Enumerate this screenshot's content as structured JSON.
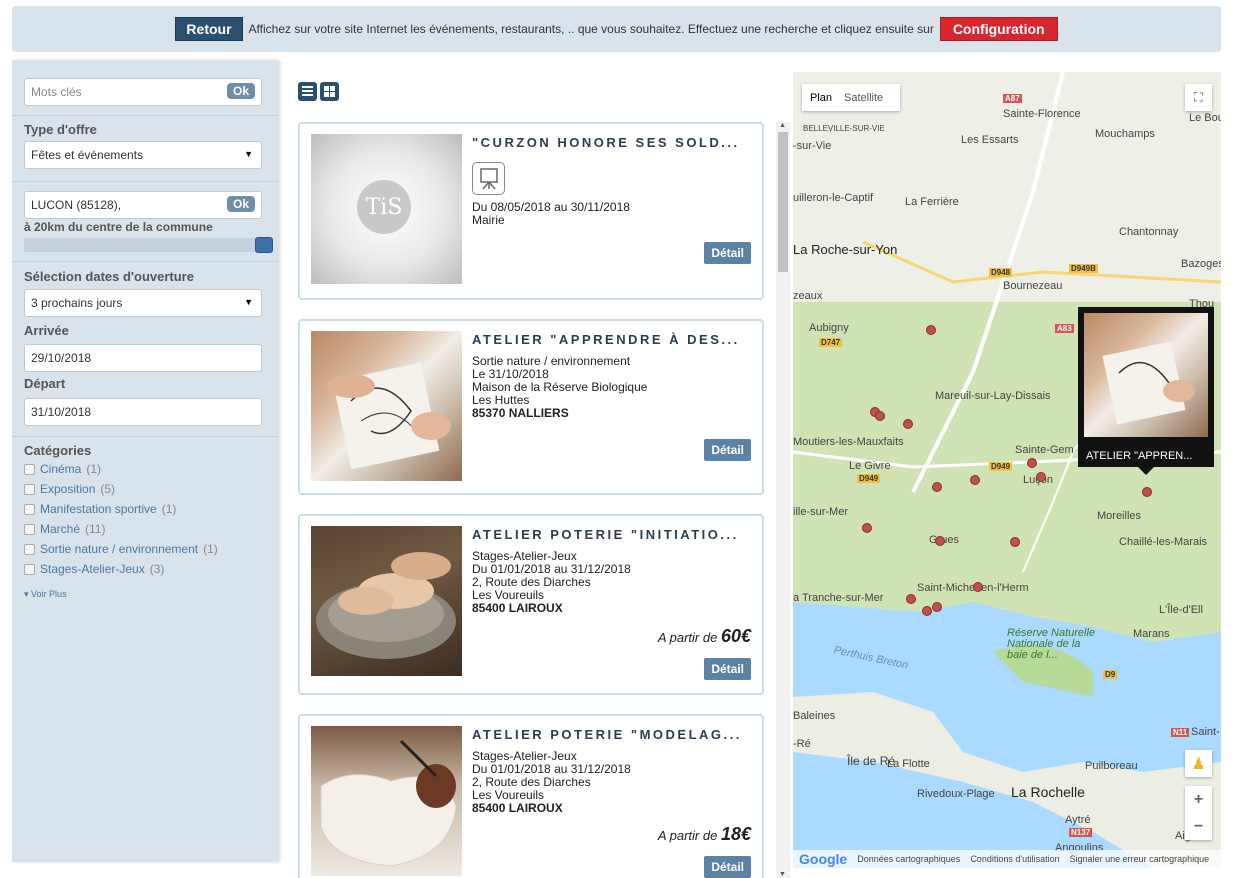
{
  "topbar": {
    "retour_label": "Retour",
    "message": "Affichez sur votre site Internet les événements, restaurants, .. que vous souhaitez. Effectuez une recherche et cliquez ensuite sur",
    "config_label": "Configuration"
  },
  "sidebar": {
    "keywords_placeholder": "Mots clés",
    "ok_label": "Ok",
    "type_label": "Type d'offre",
    "type_value": "Fêtes et événements",
    "location_value": "LUCON (85128),",
    "radius_label": "à 20km du centre de la commune",
    "radius_level": 1.0,
    "dates_label": "Sélection dates d'ouverture",
    "dates_value": "3 prochains jours",
    "arrival_label": "Arrivée",
    "arrival_value": "29/10/2018",
    "departure_label": "Départ",
    "departure_value": "31/10/2018",
    "categories_label": "Catégories",
    "categories": [
      {
        "name": "Cinéma",
        "count": "(1)"
      },
      {
        "name": "Exposition",
        "count": "(5)"
      },
      {
        "name": "Manifestation sportive",
        "count": "(1)"
      },
      {
        "name": "Marché",
        "count": "(11)"
      },
      {
        "name": "Sortie nature / environnement",
        "count": "(1)"
      },
      {
        "name": "Stages-Atelier-Jeux",
        "count": "(3)"
      }
    ],
    "more_label": "Voir Plus"
  },
  "list": {
    "detail_label": "Détail",
    "price_prefix": "A partir de",
    "cards": [
      {
        "title": "\"CURZON HONORE SES SOLD...",
        "lines": [
          "Du 08/05/2018 au 30/11/2018",
          "Mairie"
        ],
        "placeholder_logo": "TiS"
      },
      {
        "title": "ATELIER \"APPRENDRE À DES...",
        "lines": [
          "Sortie nature / environnement",
          "Le 31/10/2018",
          "Maison de la Réserve Biologique",
          "Les Huttes"
        ],
        "postal": "85370",
        "city": "NALLIERS"
      },
      {
        "title": "ATELIER POTERIE \"INITIATIO...",
        "lines": [
          "Stages-Atelier-Jeux",
          "Du 01/01/2018 au 31/12/2018",
          "2, Route des Diarches",
          "Les Voureuils"
        ],
        "postal": "85400",
        "city": "LAIROUX",
        "price": "60€"
      },
      {
        "title": "ATELIER POTERIE \"MODELAG...",
        "lines": [
          "Stages-Atelier-Jeux",
          "Du 01/01/2018 au 31/12/2018",
          "2, Route des Diarches",
          "Les Voureuils"
        ],
        "postal": "85400",
        "city": "LAIROUX",
        "price": "18€"
      }
    ]
  },
  "map": {
    "plan_label": "Plan",
    "satellite_label": "Satellite",
    "popup_title": "ATELIER \"APPREN...",
    "footer_google": "Google",
    "footer_data": "Données cartographiques",
    "footer_terms": "Conditions d'utilisation",
    "footer_report": "Signaler une erreur cartographique",
    "places": [
      "Sainte-Florence",
      "Le Bou",
      "BELLEVILLE-SUR-VIE",
      "Mouchamps",
      "Les Essarts",
      "-sur-Vie",
      "uilleron-le-Captif",
      "La Ferrière",
      "Chantonnay",
      "La Roche-sur-Yon",
      "Bazoges-",
      "Bournezeau",
      "Thou",
      "zeaux",
      "Aubigny",
      "Mareuil-sur-Lay-Dissais",
      "Moutiers-les-Mauxfaits",
      "Sainte-Gem",
      "Le Givre",
      "Luçon",
      "ille-sur-Mer",
      "Moreilles",
      "Grues",
      "Chaillé-les-Marais",
      "Saint-Michel-en-l'Herm",
      "a Tranche-sur-Mer",
      "L'Île-d'Ell",
      "Marans",
      "Réserve Naturelle Nationale de la baie de l...",
      "Perthuis Breton",
      "Baleines",
      "-Ré",
      "Île de Ré",
      "La Flotte",
      "Puilboreau",
      "Rivedoux-Plage",
      "La Rochelle",
      "Aytré",
      "Aigre",
      "Angoulins",
      "Saint-"
    ],
    "roads": [
      "A87",
      "D948",
      "D949B",
      "D747",
      "A83",
      "D949",
      "D949",
      "D9",
      "N11",
      "N137"
    ]
  }
}
